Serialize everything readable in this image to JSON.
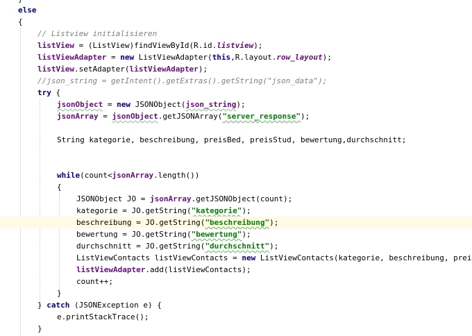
{
  "editor": {
    "lines": [
      {
        "id": "l1",
        "text": "}"
      },
      {
        "id": "l2",
        "kw": "else"
      },
      {
        "id": "l3",
        "text": "{"
      },
      {
        "id": "l4",
        "comment": "// Listview initialisieren"
      },
      {
        "id": "l5",
        "a": "listView",
        "b": " = (ListView)findViewById(R.id.",
        "c": "listview",
        "d": ");"
      },
      {
        "id": "l6",
        "a": "listViewAdapter",
        "b": " = ",
        "kw": "new",
        "c": " ListViewAdapter(",
        "kw2": "this",
        "d": ",R.layout.",
        "e": "row_layout",
        "f": ");"
      },
      {
        "id": "l7",
        "a": "listView",
        "b": ".setAdapter(",
        "c": "listViewAdapter",
        "d": ");"
      },
      {
        "id": "l8",
        "comment": "//json_string = getIntent().getExtras().getString(\"json_data\");"
      },
      {
        "id": "l9",
        "kw": "try",
        "text": " {"
      },
      {
        "id": "l10",
        "a": "jsonObject",
        "b": " = ",
        "kw": "new",
        "c": " JSONObject(",
        "d": "json_string",
        "e": ");"
      },
      {
        "id": "l11",
        "a": "jsonArray",
        "b": " = ",
        "c": "jsonObject",
        "d": ".getJSONArray(",
        "s": "\"server_response\"",
        "e": ");"
      },
      {
        "id": "l12",
        "text": ""
      },
      {
        "id": "l13",
        "text": "String kategorie, beschreibung, preisBed, preisStud, bewertung,durchschnitt;"
      },
      {
        "id": "l14",
        "text": ""
      },
      {
        "id": "l15",
        "text": ""
      },
      {
        "id": "l16",
        "kw": "while",
        "b": "(count<",
        "c": "jsonArray",
        "d": ".length())"
      },
      {
        "id": "l17",
        "text": "{"
      },
      {
        "id": "l18",
        "b": "JSONObject JO = ",
        "c": "jsonArray",
        "d": ".getJSONObject(count);"
      },
      {
        "id": "l19",
        "b": "kategorie = JO.getString(",
        "s": "\"kategorie\"",
        "e": ");"
      },
      {
        "id": "l20",
        "b": "beschreibung = JO.getString(",
        "s": "\"beschreibung\"",
        "e": ");"
      },
      {
        "id": "l21",
        "b": "bewertung = JO.getString(",
        "s": "\"bewertung\"",
        "e": ");"
      },
      {
        "id": "l22",
        "b": "durchschnitt = JO.getString(",
        "s": "\"durchschnitt\"",
        "e": ");"
      },
      {
        "id": "l23",
        "b": "ListViewContacts listViewContacts = ",
        "kw": "new",
        "c": " ListViewContacts(kategorie, beschreibung, preisBed, preisStud, bewertung, durchschnitt);"
      },
      {
        "id": "l24",
        "a": "listViewAdapter",
        "b": ".add(listViewContacts);"
      },
      {
        "id": "l25",
        "text": "count++;"
      },
      {
        "id": "l26",
        "text": "}"
      },
      {
        "id": "l27",
        "a": "} ",
        "kw": "catch",
        "b": " (JSONException e) {"
      },
      {
        "id": "l28",
        "text": "e.printStackTrace();"
      },
      {
        "id": "l29",
        "text": "}"
      }
    ]
  },
  "colors": {
    "keyword": "#000080",
    "field": "#660e7a",
    "comment": "#808080",
    "string": "#008000",
    "caret_line": "#fffae3"
  }
}
